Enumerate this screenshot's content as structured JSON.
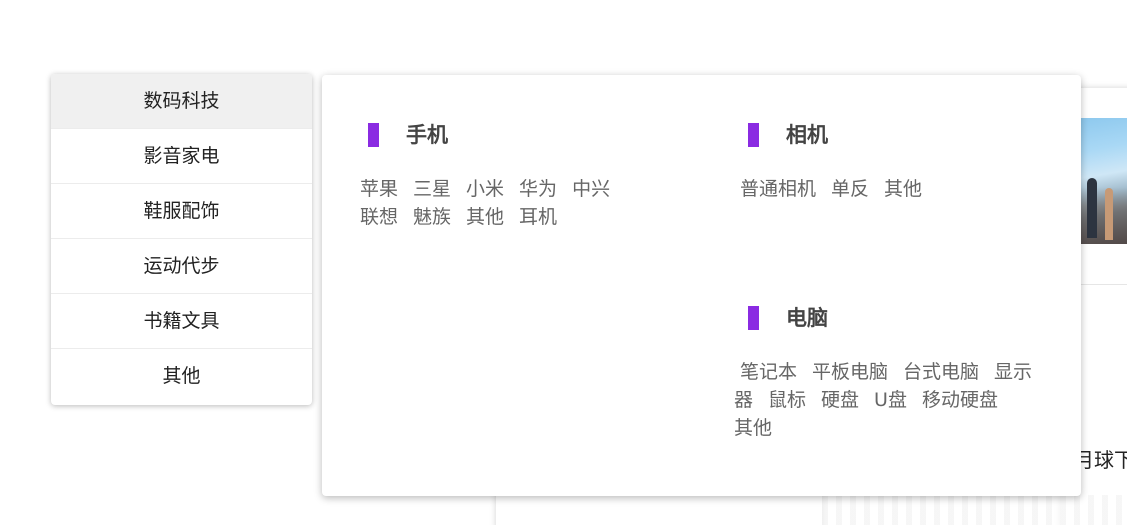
{
  "categories": [
    {
      "label": "数码科技",
      "active": true
    },
    {
      "label": "影音家电",
      "active": false
    },
    {
      "label": "鞋服配饰",
      "active": false
    },
    {
      "label": "运动代步",
      "active": false
    },
    {
      "label": "书籍文具",
      "active": false
    },
    {
      "label": "其他",
      "active": false
    }
  ],
  "panel": {
    "accent_color": "#8a2be2",
    "groups": {
      "phone": {
        "title": "手机",
        "links": [
          "苹果",
          "三星",
          "小米",
          "华为",
          "中兴",
          "联想",
          "魅族",
          "其他",
          "耳机"
        ]
      },
      "camera": {
        "title": "相机",
        "links": [
          "普通相机",
          "单反",
          "其他"
        ]
      },
      "computer": {
        "title": "电脑",
        "links": [
          "笔记本",
          "平板电脑",
          "台式电脑",
          "显示器",
          "鼠标",
          "硬盘",
          "U盘",
          "移动硬盘",
          "其他"
        ]
      }
    }
  },
  "background": {
    "partial_text": "月球下"
  }
}
